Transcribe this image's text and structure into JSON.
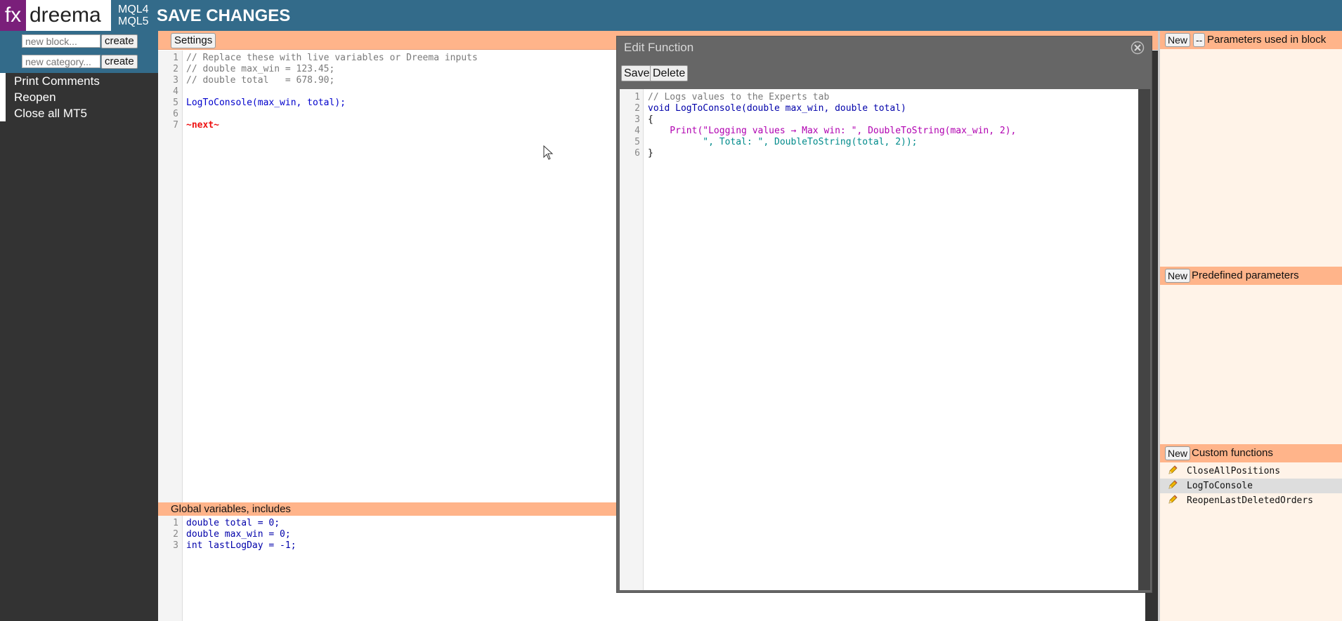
{
  "header": {
    "logo_fx": "fx",
    "logo_name": "dreema",
    "mql4": "MQL4",
    "mql5": "MQL5",
    "save_changes": "SAVE CHANGES"
  },
  "sidebar": {
    "new_block_placeholder": "new block...",
    "new_category_placeholder": "new category...",
    "create_label": "create",
    "blocks": [
      "Print Comments",
      "Reopen",
      "Close all MT5"
    ]
  },
  "editor": {
    "settings_label": "Settings",
    "code_lines": [
      "// Replace these with live variables or Dreema inputs",
      "// double max_win = 123.45;",
      "// double total   = 678.90;",
      "",
      "LogToConsole(max_win, total);",
      "",
      "~next~"
    ],
    "line_numbers": [
      "1",
      "2",
      "3",
      "4",
      "5",
      "6",
      "7"
    ]
  },
  "globals": {
    "title": "Global variables, includes",
    "line_numbers": [
      "1",
      "2",
      "3"
    ],
    "code_lines": [
      "double total = 0;",
      "double max_win = 0;",
      "int lastLogDay = -1;"
    ]
  },
  "right_panel": {
    "new_label": "New",
    "dash_label": "--",
    "params_title": "Parameters used in block",
    "predefined_title": "Predefined parameters",
    "custom_title": "Custom functions",
    "custom_functions": [
      "CloseAllPositions",
      "LogToConsole",
      "ReopenLastDeletedOrders"
    ],
    "selected_function": "LogToConsole"
  },
  "modal": {
    "title": "Edit Function",
    "save_label": "Save",
    "delete_label": "Delete",
    "line_numbers": [
      "1",
      "2",
      "3",
      "4",
      "5",
      "6"
    ],
    "code_lines": [
      "// Logs values to the Experts tab",
      "void LogToConsole(double max_win, double total)",
      "{",
      "    Print(\"Logging values → Max win: \", DoubleToString(max_win, 2),",
      "          \", Total: \", DoubleToString(total, 2));",
      "}"
    ]
  },
  "colors": {
    "topbar": "#336b8a",
    "sidebar": "#333333",
    "header_band": "#ffb48a",
    "modal_bg": "#666666",
    "logo_fx_bg": "#7a1f7a"
  },
  "icons": [
    "close-icon",
    "pencil-icon",
    "mouse-cursor-icon"
  ]
}
